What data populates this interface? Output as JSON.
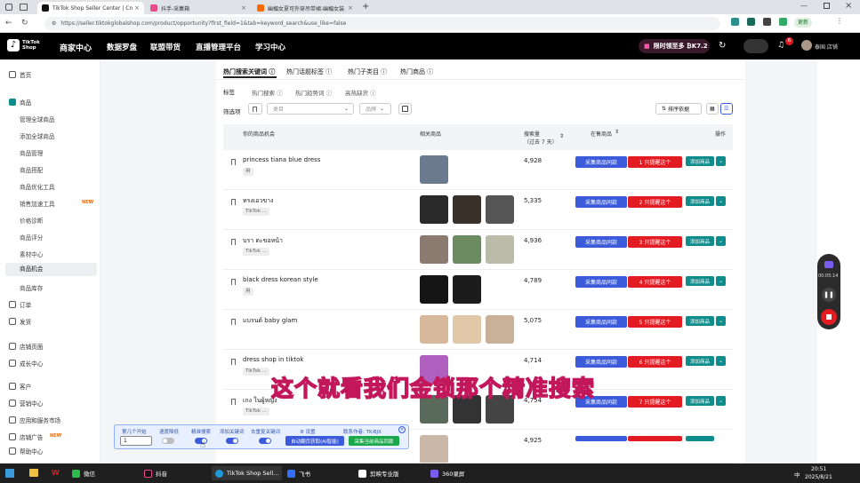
{
  "browser": {
    "tabs": [
      {
        "label": "TikTok Shop Seller Center | Cross",
        "color": "#111"
      },
      {
        "label": "抖手-采集箱",
        "color": "#e94b8a"
      },
      {
        "label": "幽楣女夏可外穿吊带裙-幽楣女装",
        "color": "#ff6a00"
      }
    ],
    "url": "https://seller.tiktokglobalshop.com/product/opportunity?first_field=1&tab=keyword_search&use_like=false",
    "update_label": "更新"
  },
  "topnav": {
    "brand": "TikTok Shop",
    "center": "商家中心",
    "items": [
      "数据罗盘",
      "联盟带货",
      "直播管理平台",
      "学习中心"
    ],
    "promo": "限时领至多 ₿K7.2",
    "badge": "6",
    "user": "泰国 店铺"
  },
  "sidebar": {
    "items": [
      {
        "label": "首页",
        "type": "top"
      },
      {
        "label": "商品",
        "type": "top"
      },
      {
        "label": "管理全球商品",
        "type": "sub"
      },
      {
        "label": "添加全球商品",
        "type": "sub"
      },
      {
        "label": "商品管理",
        "type": "sub"
      },
      {
        "label": "商品搭配",
        "type": "sub"
      },
      {
        "label": "商品优化工具",
        "type": "sub"
      },
      {
        "label": "销售加速工具",
        "type": "sub",
        "badge": "NEW"
      },
      {
        "label": "价格诊断",
        "type": "sub"
      },
      {
        "label": "商品评分",
        "type": "sub"
      },
      {
        "label": "素材中心",
        "type": "sub"
      },
      {
        "label": "商品机会",
        "type": "sub",
        "selected": true
      },
      {
        "label": "商品库存",
        "type": "sub"
      },
      {
        "label": "订单",
        "type": "top"
      },
      {
        "label": "发货",
        "type": "top"
      },
      {
        "label": "店铺页面",
        "type": "top"
      },
      {
        "label": "成长中心",
        "type": "top"
      },
      {
        "label": "客户",
        "type": "top"
      },
      {
        "label": "营销中心",
        "type": "top"
      },
      {
        "label": "应用和服务市场",
        "type": "top"
      },
      {
        "label": "店铺广告",
        "type": "top",
        "badge": "NEW"
      },
      {
        "label": "帮助中心",
        "type": "top"
      }
    ]
  },
  "main": {
    "tabs": [
      "热门搜索关键词",
      "热门话题标签",
      "热门子类目",
      "热门商品"
    ],
    "tag_label": "标签",
    "tag_options": [
      "热门搜索",
      "热门趋势词",
      "高热缺货"
    ],
    "filter_label": "筛选项",
    "category_placeholder": "类目",
    "brand_placeholder": "品牌",
    "sort_label": "排序依据",
    "columns": {
      "keyword": "你的商品机会",
      "related": "相关商品",
      "search": "搜索量",
      "search_sub": "（过去 7 天）",
      "onsale": "在售商品",
      "action": "操作"
    },
    "btn_collect": "采集商品同款",
    "btn_add": "添加商品",
    "rows": [
      {
        "keyword": "princess tiana blue dress",
        "tag": "用",
        "search": "4,928",
        "remind": "1 只提醒这个",
        "thumbs": [
          "#6b7a8c"
        ]
      },
      {
        "keyword": "ทรงเอวขาง",
        "tag": "TikTok ...",
        "search": "5,335",
        "remind": "2 只提醒这个",
        "thumbs": [
          "#2a2a2a",
          "#3a302a",
          "#555"
        ]
      },
      {
        "keyword": "บรา ตะขอหน้า",
        "tag": "TikTok ...",
        "search": "4,936",
        "remind": "3 只提醒这个",
        "thumbs": [
          "#8a7a70",
          "#6a8a60",
          "#bba"
        ]
      },
      {
        "keyword": "black dress korean style",
        "tag": "用",
        "search": "4,789",
        "remind": "4 只提醒这个",
        "thumbs": [
          "#151515",
          "#1c1c1c"
        ]
      },
      {
        "keyword": "แบรนด์ baby glam",
        "tag": "",
        "search": "5,075",
        "remind": "5 只提醒这个",
        "thumbs": [
          "#d8b89a",
          "#e0c8a8",
          "#c9b098"
        ]
      },
      {
        "keyword": "dress shop in tiktok",
        "tag": "TikTok ...",
        "search": "4,714",
        "remind": "6 只提醒这个",
        "thumbs": [
          "#b060c0"
        ]
      },
      {
        "keyword": "เกง ในผู้หญิง",
        "tag": "TikTok ...",
        "search": "4,754",
        "remind": "7 只提醒这个",
        "thumbs": [
          "#5a6a5a",
          "#333",
          "#444"
        ]
      },
      {
        "keyword": "",
        "tag": "",
        "search": "4,925",
        "remind": "",
        "thumbs": [
          "#c9b8a8"
        ]
      }
    ]
  },
  "subtitle": "这个就看我们金锁那个精准搜索",
  "toolbar": {
    "labels": [
      "第几个开始",
      "速度降低",
      "精准搜索",
      "添加关键词",
      "去重复关键词",
      "⚙ 设置",
      "联系作者: TK-BJX"
    ],
    "start_value": "1",
    "btn_auto": "自动翻页获取(AI智能)",
    "btn_collect": "采集当前商品同款"
  },
  "recorder": {
    "time": "00:05:14"
  },
  "taskbar": {
    "items": [
      "微信",
      "抖音",
      "TikTok Shop Sell...",
      "飞书",
      "剪映专业版",
      "360录屏"
    ],
    "time": "20:51",
    "date": "2025/8/21",
    "ime": "中"
  },
  "colors": {
    "brand_blue": "#3b5bdb",
    "remind_red": "#e31b23",
    "add_teal": "#0f8c8c"
  }
}
